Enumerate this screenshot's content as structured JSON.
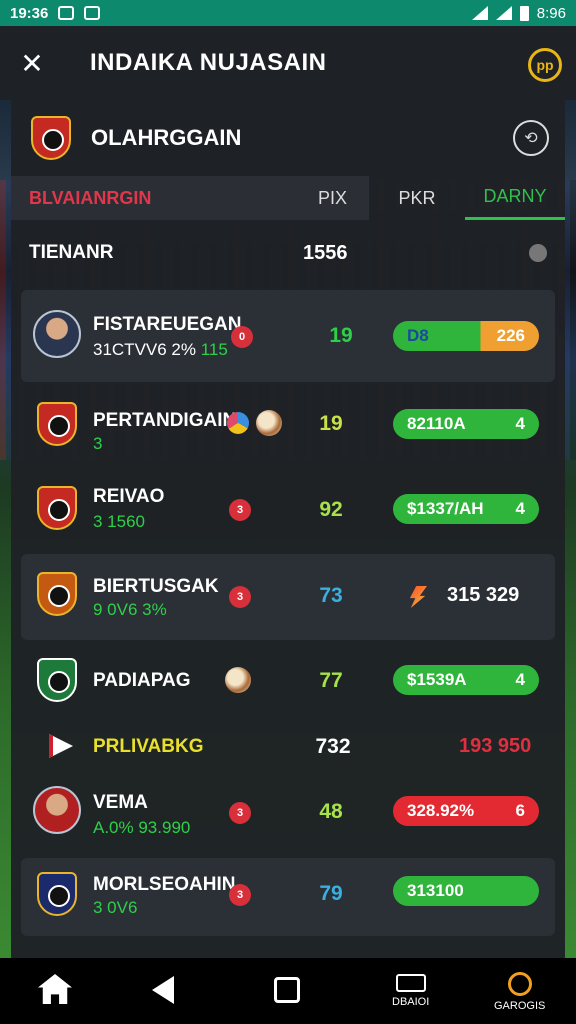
{
  "status_bar": {
    "time": "19:36",
    "right_time": "8:96"
  },
  "top_bar": {
    "title": "INDAIKA NUJASAIN",
    "action_icon": "pp"
  },
  "team_header": {
    "name": "OLAHRGGAIN"
  },
  "tabs": {
    "a": "BLVAIANRGIN",
    "a_sub": "PIX",
    "b": "PKR",
    "c": "DARNY"
  },
  "total": {
    "label": "TIENANR",
    "value": "1556"
  },
  "rows": [
    {
      "name": "FISTAREUEGAN",
      "sub_a": "31CTVV6 2% ",
      "sub_b": "115",
      "badge": "0",
      "score": "19",
      "pill_left": "D8",
      "pill_right": "226"
    },
    {
      "name": "PERTANDIGAIN",
      "sub_a": "",
      "sub_b": "3",
      "score": "19",
      "pill_left": "82110A",
      "pill_right": "4"
    },
    {
      "name": "REIVAO",
      "sub_a": "",
      "sub_b": "3 1560",
      "badge": "3",
      "score": "92",
      "pill_left": "$1337/AH",
      "pill_right": "4"
    },
    {
      "name": "BIERTUSGAK",
      "sub_a": "",
      "sub_b": "9 0V6 3%",
      "badge": "3",
      "score": "73",
      "value": "315 329"
    },
    {
      "name": "PADIAPAG",
      "score": "77",
      "pill_left": "$1539A",
      "pill_right": "4"
    },
    {
      "name": "PRLIVABKG",
      "score": "732",
      "value": "193 950"
    },
    {
      "name": "VEMA",
      "sub_a": "",
      "sub_b": "A.0% 93.990",
      "badge": "3",
      "score": "48",
      "pill_left": "328.92%",
      "pill_right": "6"
    },
    {
      "name": "MORLSEOAHIN",
      "sub_a": "",
      "sub_b": "3 0V6",
      "badge": "3",
      "score": "79",
      "pill_left": "313100",
      "pill_right": ""
    }
  ],
  "nav": {
    "item4": "DBAIOI",
    "item5": "GAROGIS"
  },
  "colors": {
    "status_bar": "#0d8a6e",
    "green": "#2fb53c",
    "red": "#e32a33",
    "accent_yellow": "#e8b615",
    "tab_active": "#2ec24a",
    "tab_red": "#e0374a"
  }
}
